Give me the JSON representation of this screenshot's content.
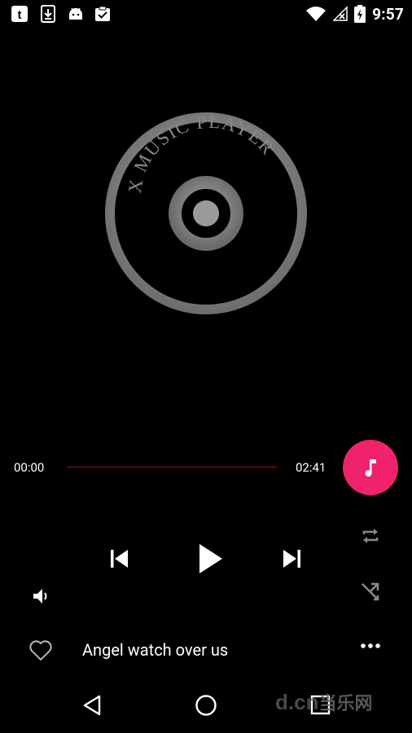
{
  "status_bar": {
    "time": "9:57",
    "left_icons": [
      "tumblr-icon",
      "download-icon",
      "android-icon",
      "clipboard-check-icon"
    ],
    "right_icons": [
      "wifi-icon",
      "no-signal-icon",
      "battery-charging-icon"
    ]
  },
  "logo": {
    "text": "X MUSIC PLAYER"
  },
  "player": {
    "elapsed": "00:00",
    "duration": "02:41",
    "progress": 0,
    "accent_color": "#f0226b"
  },
  "now_playing": {
    "title": "Angel watch over us"
  },
  "watermark": {
    "text": "d.cn",
    "cn_text": "当乐网"
  },
  "colors": {
    "background": "#000000",
    "accent": "#f0226b",
    "disc": "#8a8a8a"
  }
}
